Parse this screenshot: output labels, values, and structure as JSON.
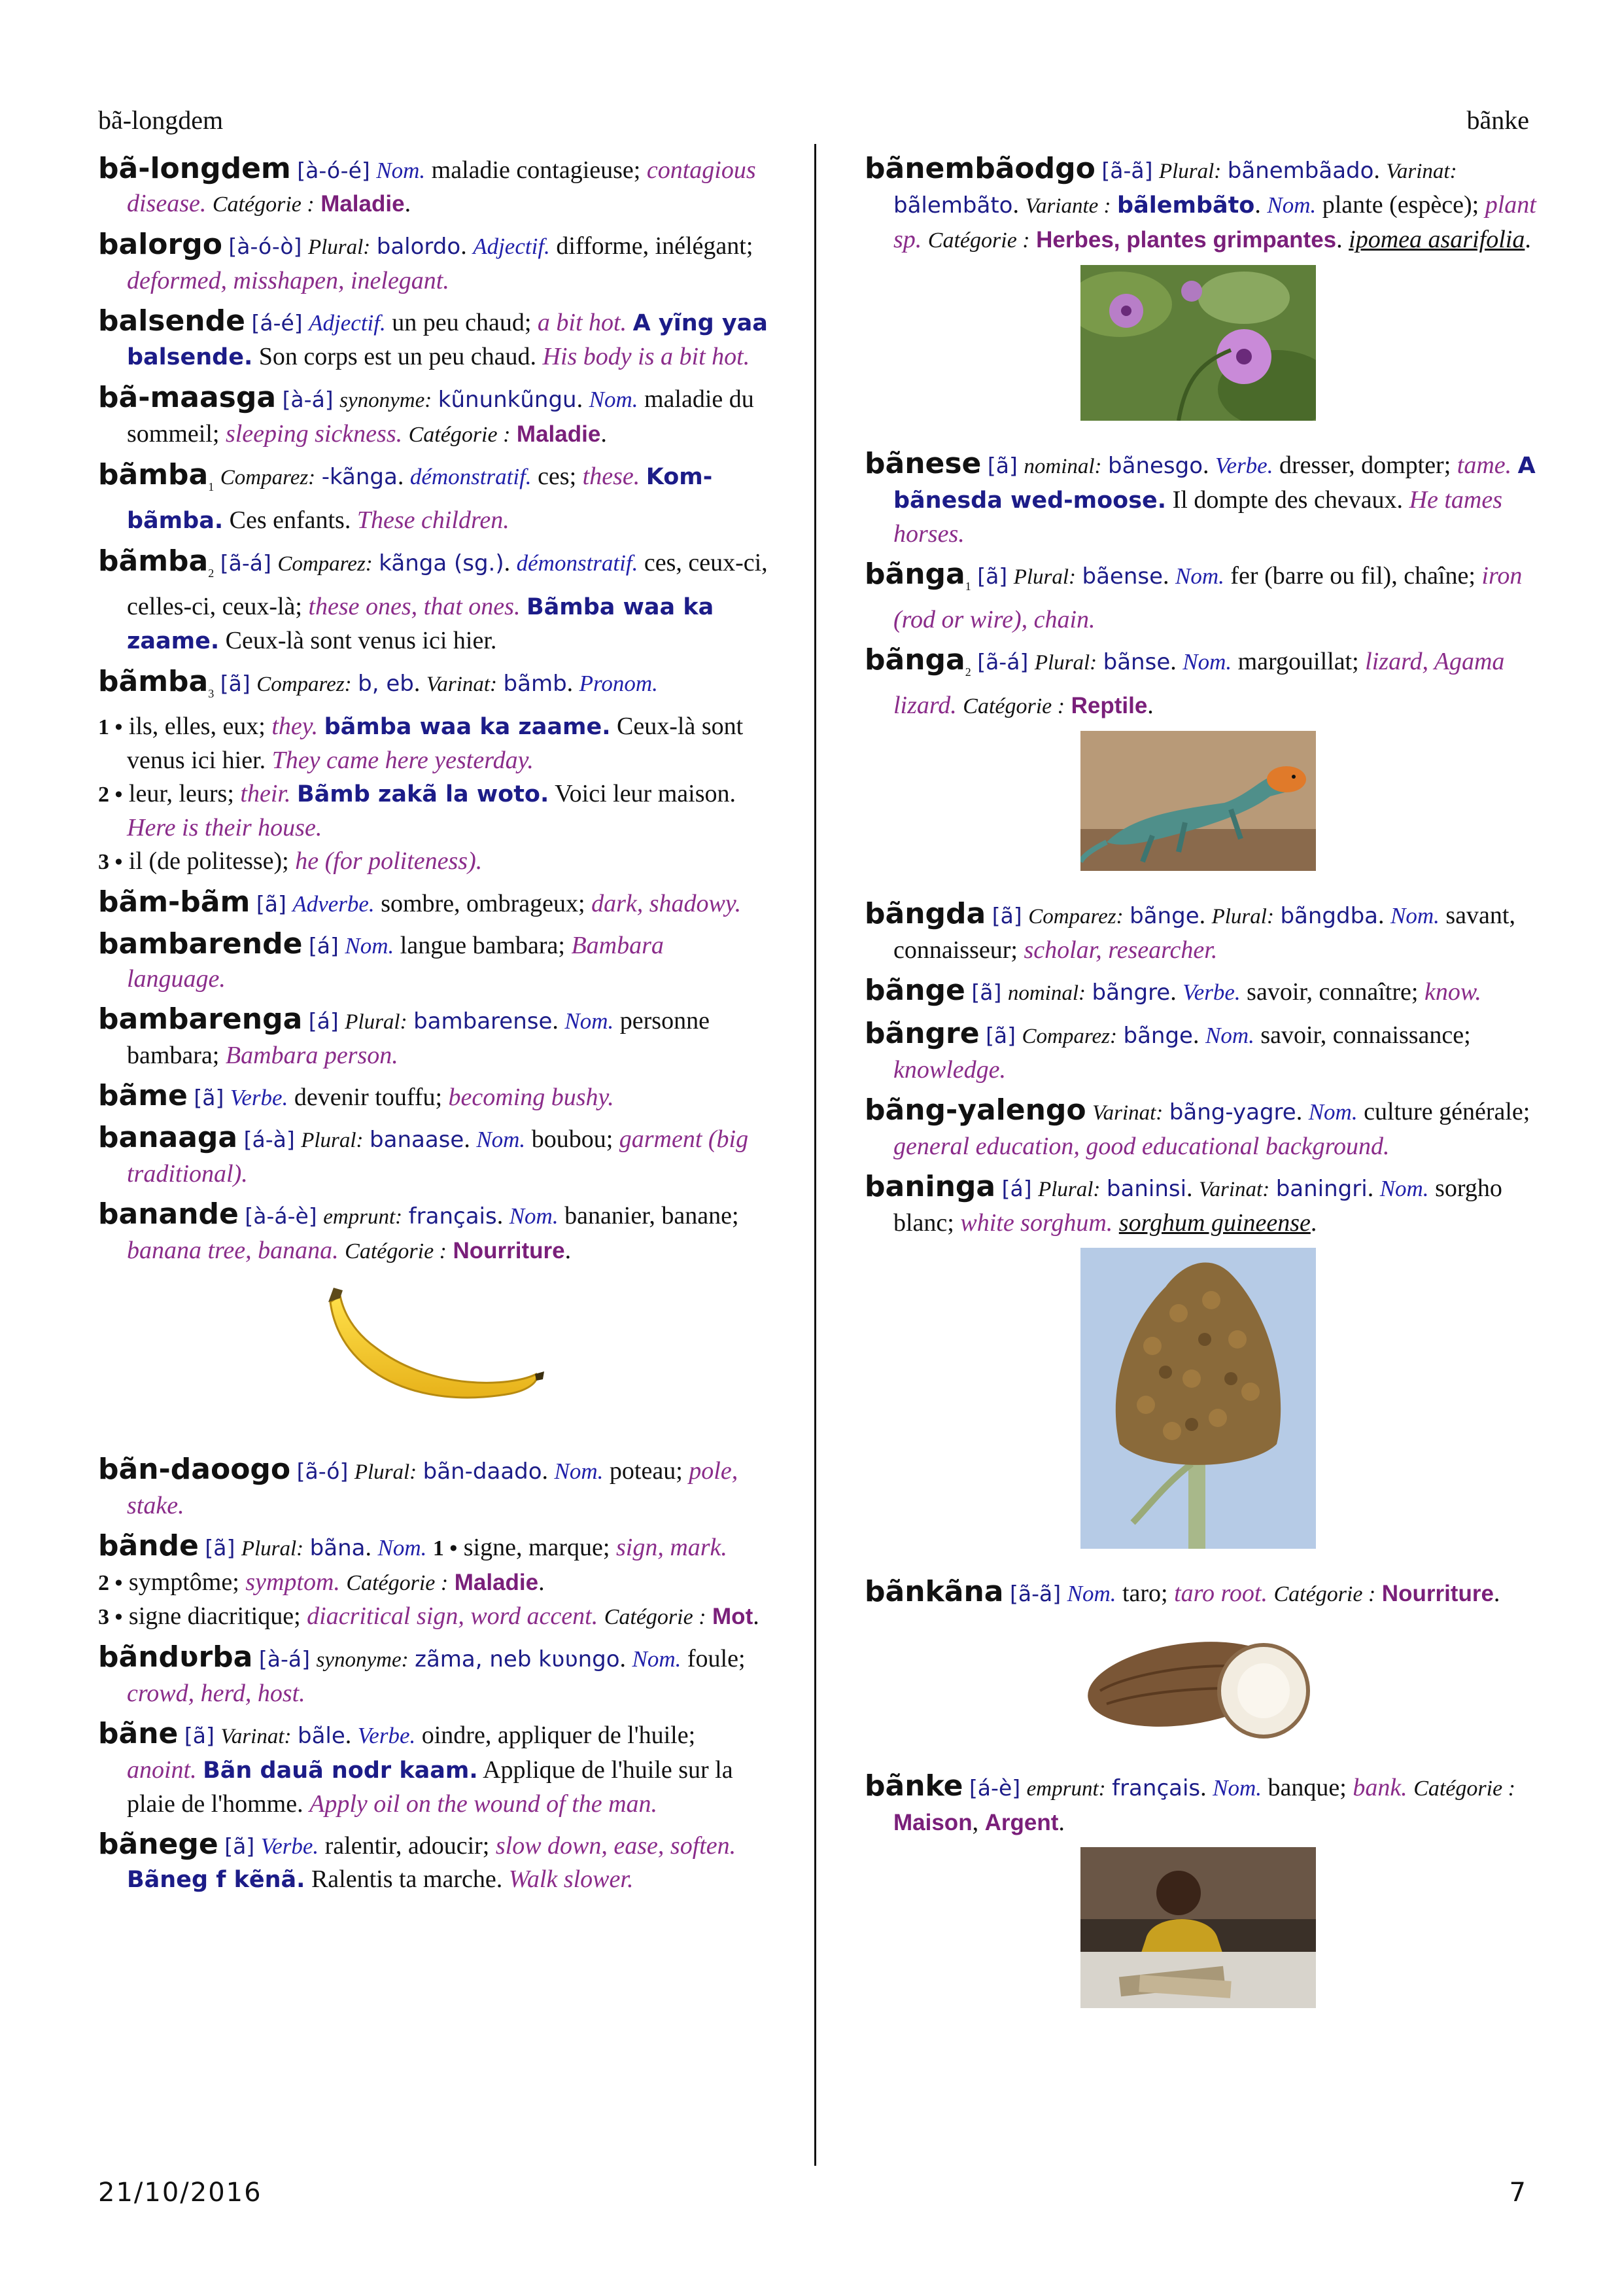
{
  "header": {
    "left": "bã-longdem",
    "right": "bãnke"
  },
  "footer": {
    "date": "21/10/2016",
    "page": "7"
  },
  "labels": {
    "nom": "Nom.",
    "verbe": "Verbe.",
    "adj": "Adjectif.",
    "adv": "Adverbe.",
    "pron": "Pronom.",
    "dem": "démonstratif.",
    "plural": "Plural:",
    "comparez": "Comparez:",
    "varinat": "Varinat:",
    "variante": "Variante :",
    "synonyme": "synonyme:",
    "emprunt": "emprunt:",
    "nominal": "nominal:",
    "categorie": "Catégorie :"
  },
  "left": {
    "e1": {
      "hw": "bã-longdem",
      "ph": "[à-ó-é]",
      "fr": "maladie contagieuse;",
      "en": "contagious disease.",
      "cat": "Maladie"
    },
    "e2": {
      "hw": "balorgo",
      "ph": "[à-ó-ò]",
      "pl": "balordo",
      "fr": "difforme, inélégant;",
      "en": "deformed, misshapen, inelegant."
    },
    "e3": {
      "hw": "balsende",
      "ph": "[á-é]",
      "fr": "un peu chaud;",
      "en": "a bit hot.",
      "ex": "A yĩng yaa balsende.",
      "exfr": "Son corps est un peu chaud.",
      "exen": "His body is a bit hot."
    },
    "e4": {
      "hw": "bã-maasga",
      "ph": "[à-á]",
      "syn": "kũnunkũngu",
      "fr": "maladie du sommeil;",
      "en": "sleeping sickness.",
      "cat": "Maladie"
    },
    "e5": {
      "hw": "bãmba",
      "sub": "1",
      "cmp": "-kãnga",
      "fr": "ces;",
      "en": "these.",
      "ex": "Kom-bãmba.",
      "exfr": "Ces enfants.",
      "exen": "These children."
    },
    "e6": {
      "hw": "bãmba",
      "sub": "2",
      "ph": "[ã-á]",
      "cmp": "kãnga (sg.)",
      "fr": "ces, ceux-ci, celles-ci, ceux-là;",
      "en": "these ones, that ones.",
      "ex": "Bãmba waa ka zaame.",
      "exfr": "Ceux-là sont venus ici hier."
    },
    "e7": {
      "hw": "bãmba",
      "sub": "3",
      "ph": "[ã]",
      "cmp": "b, eb",
      "var": "bãmb",
      "s1n": "1 •",
      "s1fr": "ils, elles, eux;",
      "s1en": "they.",
      "s1ex": "bãmba waa ka zaame.",
      "s1exfr": "Ceux-là sont venus ici hier.",
      "s1exen": "They came here yesterday.",
      "s2n": "2 •",
      "s2fr": "leur, leurs;",
      "s2en": "their.",
      "s2ex": "Bãmb zakã la woto.",
      "s2exfr": "Voici leur maison.",
      "s2exen": "Here is their house.",
      "s3n": "3 •",
      "s3fr": "il (de politesse);",
      "s3en": "he (for politeness)."
    },
    "e8": {
      "hw": "bãm-bãm",
      "ph": "[ã]",
      "fr": "sombre, ombrageux;",
      "en": "dark, shadowy."
    },
    "e9": {
      "hw": "bambarende",
      "ph": "[á]",
      "fr": "langue bambara;",
      "en": "Bambara language."
    },
    "e10": {
      "hw": "bambarenga",
      "ph": "[á]",
      "pl": "bambarense",
      "fr": "personne bambara;",
      "en": "Bambara person."
    },
    "e11": {
      "hw": "bãme",
      "ph": "[ã]",
      "fr": "devenir touffu;",
      "en": "becoming bushy."
    },
    "e12": {
      "hw": "banaaga",
      "ph": "[á-à]",
      "pl": "banaase",
      "fr": "boubou;",
      "en": "garment (big traditional)."
    },
    "e13": {
      "hw": "banande",
      "ph": "[à-á-è]",
      "emp": "français",
      "fr": "bananier, banane;",
      "en": "banana tree, banana.",
      "cat": "Nourriture"
    },
    "e14": {
      "hw": "bãn-daoogo",
      "ph": "[ã-ó]",
      "pl": "bãn-daado",
      "fr": "poteau;",
      "en": "pole, stake."
    },
    "e15": {
      "hw": "bãnde",
      "ph": "[ã]",
      "pl": "bãna",
      "s1n": "1 •",
      "s1fr": "signe, marque;",
      "s1en": "sign, mark.",
      "s2n": "2 •",
      "s2fr": "symptôme;",
      "s2en": "symptom.",
      "s2cat": "Maladie",
      "s3n": "3 •",
      "s3fr": "signe diacritique;",
      "s3en": "diacritical sign, word accent.",
      "s3cat": "Mot"
    },
    "e16": {
      "hw": "bãndʋrba",
      "ph": "[à-á]",
      "syn": "zãma, neb kʋʋngo",
      "fr": "foule;",
      "en": "crowd, herd, host."
    },
    "e17": {
      "hw": "bãne",
      "ph": "[ã]",
      "var": "bãle",
      "fr": "oindre, appliquer de l'huile;",
      "en": "anoint.",
      "ex": "Bãn dauã nodr kaam.",
      "exfr": "Applique de l'huile sur la plaie de l'homme.",
      "exen": "Apply oil on the wound of the man."
    },
    "e18": {
      "hw": "bãnege",
      "ph": "[ã]",
      "fr": "ralentir, adoucir;",
      "en": "slow down, ease, soften.",
      "ex": "Bãneg f kẽnã.",
      "exfr": "Ralentis ta marche.",
      "exen": "Walk slower."
    }
  },
  "right": {
    "r1": {
      "hw": "bãnembãodgo",
      "ph": "[ã-ã]",
      "pl": "bãnembãado",
      "var": "bãlembãto",
      "vte": "bãlembãto",
      "fr": "plante (espèce);",
      "en": "plant sp.",
      "cat": "Herbes, plantes grimpantes",
      "sci": "ipomea asarifolia"
    },
    "r2": {
      "hw": "bãnese",
      "ph": "[ã]",
      "nominal": "bãnesgo",
      "fr": "dresser, dompter;",
      "en": "tame.",
      "ex": "A bãnesda wed-moose.",
      "exfr": "Il dompte des chevaux.",
      "exen": "He tames horses."
    },
    "r3": {
      "hw": "bãnga",
      "sub": "1",
      "ph": "[ã]",
      "pl": "bãense",
      "fr": "fer (barre ou fil), chaîne;",
      "en": "iron (rod or wire), chain."
    },
    "r4": {
      "hw": "bãnga",
      "sub": "2",
      "ph": "[ã-á]",
      "pl": "bãnse",
      "fr": "margouillat;",
      "en": "lizard, Agama lizard.",
      "cat": "Reptile"
    },
    "r5": {
      "hw": "bãngda",
      "ph": "[ã]",
      "cmp": "bãnge",
      "pl": "bãngdba",
      "fr": "savant, connaisseur;",
      "en": "scholar, researcher."
    },
    "r6": {
      "hw": "bãnge",
      "ph": "[ã]",
      "nominal": "bãngre",
      "fr": "savoir, connaître;",
      "en": "know."
    },
    "r7": {
      "hw": "bãngre",
      "ph": "[ã]",
      "cmp": "bãnge",
      "fr": "savoir, connaissance;",
      "en": "knowledge."
    },
    "r8": {
      "hw": "bãng-yalengo",
      "var": "bãng-yagre",
      "fr": "culture générale;",
      "en": "general education, good educational background."
    },
    "r9": {
      "hw": "baninga",
      "ph": "[á]",
      "pl": "baninsi",
      "var": "baningri",
      "fr": "sorgho blanc;",
      "en": "white sorghum.",
      "sci": "sorghum guineense"
    },
    "r10": {
      "hw": "bãnkãna",
      "ph": "[ã-ã]",
      "fr": "taro;",
      "en": "taro root.",
      "cat": "Nourriture"
    },
    "r11": {
      "hw": "bãnke",
      "ph": "[á-è]",
      "emp": "français",
      "fr": "banque;",
      "en": "bank.",
      "cat1": "Maison",
      "cat2": "Argent"
    }
  },
  "images": {
    "banana": "banana-photo",
    "flower": "purple-flower-photo",
    "lizard": "lizard-photo",
    "sorghum": "sorghum-photo",
    "taro": "taro-photo",
    "bank": "bank-photo"
  }
}
